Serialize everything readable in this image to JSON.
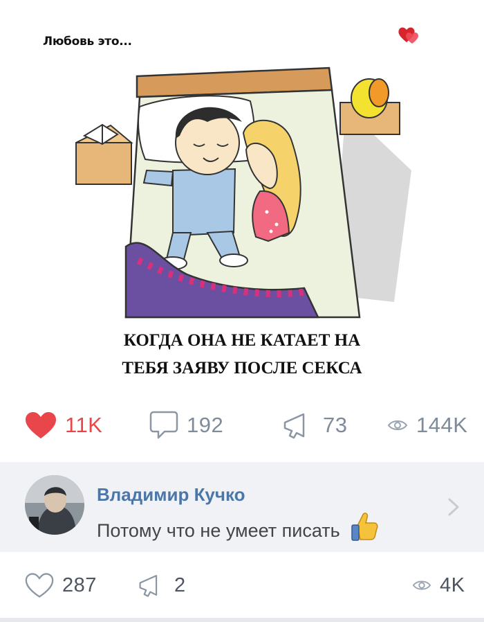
{
  "post": {
    "brand_title": "Любовь это...",
    "caption_line1": "КОГДА ОНА НЕ КАТАЕТ НА",
    "caption_line2": "ТЕБЯ ЗАЯВУ ПОСЛЕ СЕКСА",
    "stats": {
      "likes": "11K",
      "comments": "192",
      "reposts": "73",
      "views": "144K"
    },
    "liked": true
  },
  "comment": {
    "author": "Владимир Кучко",
    "text": "Потому что не умеет писать",
    "emoji": "👍",
    "stats": {
      "likes": "287",
      "reposts": "2",
      "views": "4K"
    }
  },
  "colors": {
    "like_active": "#e8464a",
    "icon_gray": "#7f8b99",
    "name_blue": "#4a76a8",
    "comment_bg": "#f0f2f5"
  },
  "icons": {
    "heart": "heart-icon",
    "comment": "comment-icon",
    "repost": "megaphone-icon",
    "views": "eye-icon",
    "chevron": "chevron-right-icon",
    "decor_hearts": "double-heart-icon"
  }
}
